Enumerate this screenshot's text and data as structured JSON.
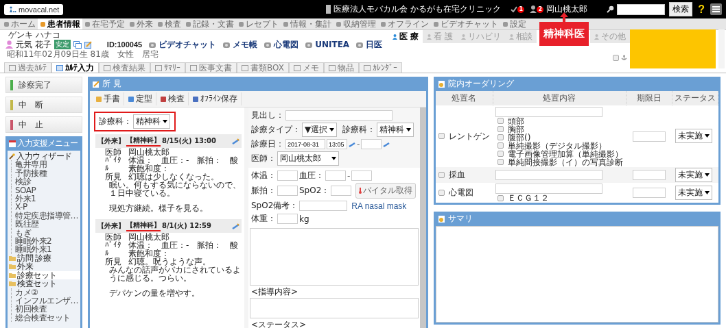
{
  "topbar": {
    "logo": "movacal.net",
    "clinic": "医療法人モバカル会 かるがも在宅クリニック",
    "task_count": "1",
    "user_count": "2",
    "user": "岡山桃太郎",
    "search_button": "検索",
    "help": "?"
  },
  "callout": {
    "text": "精神科医"
  },
  "nav": [
    {
      "label": "ホーム",
      "selected": false
    },
    {
      "label": "患者情報",
      "selected": true
    },
    {
      "label": "在宅予定",
      "selected": false
    },
    {
      "label": "外来",
      "selected": false
    },
    {
      "label": "検査",
      "selected": false
    },
    {
      "label": "記録・文書",
      "selected": false
    },
    {
      "label": "レセプト",
      "selected": false
    },
    {
      "label": "情報・集計",
      "selected": false
    },
    {
      "label": "収納管理",
      "selected": false
    },
    {
      "label": "オフライン",
      "selected": false
    },
    {
      "label": "ビデオチャット",
      "selected": false
    },
    {
      "label": "設定",
      "selected": false
    }
  ],
  "patient": {
    "kana": "ゲンキ ハナコ",
    "name": "元気 花子",
    "status": "安定",
    "id": "ID:100045",
    "links": [
      "ビデオチャット",
      "メモ帳",
      "心電図",
      "UNITEA",
      "日医"
    ],
    "birth": "昭和11年02月09日生 81歳",
    "sex": "女性",
    "residence": "居宅",
    "pin_checked": false
  },
  "staff_tabs": [
    {
      "label": "医 療",
      "selected": true
    },
    {
      "label": "看 護",
      "selected": false
    },
    {
      "label": "リハビリ",
      "selected": false
    },
    {
      "label": "相談",
      "selected": false
    },
    {
      "label": "その他",
      "selected": false
    }
  ],
  "record_tabs": [
    {
      "label": "過去ｶﾙﾃ",
      "selected": false
    },
    {
      "label": "ｶﾙﾃ入力",
      "selected": true
    },
    {
      "label": "検査結果",
      "selected": false
    },
    {
      "label": "ｻﾏﾘｰ",
      "selected": false
    },
    {
      "label": "医事文書",
      "selected": false
    },
    {
      "label": "書類BOX",
      "selected": false
    },
    {
      "label": "メモ",
      "selected": false
    },
    {
      "label": "物品",
      "selected": false
    },
    {
      "label": "ｶﾚﾝﾀﾞｰ",
      "selected": false
    }
  ],
  "actions": [
    {
      "label": "診察完了",
      "color": "#4cae4c"
    },
    {
      "label": "中　断",
      "color": "#c2b84a"
    },
    {
      "label": "中　止",
      "color": "#c9566a"
    }
  ],
  "support_menu": {
    "title": "入力支援メニュー",
    "items": [
      {
        "label": "入力ウィザード",
        "kind": "wizard",
        "selected": false,
        "children": [
          "亀井専用",
          "予防接種",
          "検診",
          "SOAP",
          "外来1",
          "X-P",
          "特定疾患指導管…",
          "既往歴",
          "もぎ",
          "睡眠外来2",
          "睡眠外来1"
        ]
      },
      {
        "label": "訪問 診療",
        "kind": "folder",
        "selected": false
      },
      {
        "label": "外来",
        "kind": "folder",
        "selected": false
      },
      {
        "label": "診療セット",
        "kind": "folder",
        "selected": true
      },
      {
        "label": "検査セット",
        "kind": "folder",
        "selected": false,
        "children": [
          "カメ②",
          "インフルエンザ…",
          "初回検査",
          "総合検査セット"
        ]
      }
    ]
  },
  "findings": {
    "title": "所 見",
    "toolbar": [
      "手書",
      "定型",
      "検査",
      "ｵﾌﾗｲﾝ保存"
    ],
    "filter_label": "診療科：",
    "filter_value": "精神科",
    "entries": [
      {
        "visit": "【外来】",
        "dept": "【精神科】",
        "date": "8/15(火) 13:00",
        "doctor_label": "医師",
        "doctor": "岡山桃太郎",
        "vital_label": "ﾊﾞｲﾀﾙ",
        "vitals": "体温：　血圧：-　脈拍：　酸素飽和度：",
        "finding_label": "所見",
        "finding": "幻聴は少しなくなった。",
        "paragraphs": [
          "眠い。何もする気にならないので、１日中寝ている。",
          "現処方継続。様子を見る。"
        ]
      },
      {
        "visit": "【外来】",
        "dept": "【精神科】",
        "date": "8/1(火) 12:59",
        "doctor_label": "医師",
        "doctor": "岡山桃太郎",
        "vital_label": "ﾊﾞｲﾀﾙ",
        "vitals": "体温：　血圧：-　脈拍：　酸素飽和度：",
        "finding_label": "所見",
        "finding": "幻聴。呪うような声。",
        "paragraphs": [
          "みんなの話声がバカにされているように感じる。つらい。",
          "デパケンの量を増やす。"
        ]
      }
    ]
  },
  "form": {
    "heading_label": "見出し：",
    "type_label": "診療タイプ：",
    "type_value": "▼選択",
    "dept_label": "診療科：",
    "dept_value": "精神科",
    "date_label": "診療日：",
    "date": "2017-08-31",
    "time": "13:05",
    "doctor_label": "医師：",
    "doctor": "岡山桃太郎",
    "temp_label": "体温：",
    "bp_label": "血圧：",
    "pulse_label": "脈拍：",
    "spo2_label": "SpO2：",
    "vital_button": "バイタル取得",
    "spo2_note_label": "SpO2備考：",
    "spo2_hint": "RA nasal mask",
    "weight_label": "体重：",
    "weight_unit": "kg",
    "time_separator": "-",
    "bp_separator": "-",
    "guidance_label": "<指導内容>",
    "status_label": "<ステータス>"
  },
  "orders": {
    "title": "院内オーダリング",
    "columns": [
      "処置名",
      "処置内容",
      "期限日",
      "ステータス"
    ],
    "rows": [
      {
        "name": "レントゲン",
        "checked": false,
        "status": "未実施",
        "options": [
          {
            "label": "頭部",
            "checked": false
          },
          {
            "label": "胸部",
            "checked": false
          },
          {
            "label": "腹部()",
            "checked": false
          },
          {
            "label": "単純撮影（デジタル撮影）",
            "checked": false
          },
          {
            "label": "電子画像管理加算（単純撮影）",
            "checked": false
          },
          {
            "label": "単純間接撮影（イ）の写真診断",
            "checked": false
          }
        ]
      },
      {
        "name": "採血",
        "checked": false,
        "status": "未実施"
      },
      {
        "name": "心電図",
        "checked": false,
        "status": "未実施",
        "options": [
          {
            "label": "ＥＣＧ１２",
            "checked": false
          }
        ]
      }
    ]
  },
  "summary": {
    "title": "サマリ"
  }
}
